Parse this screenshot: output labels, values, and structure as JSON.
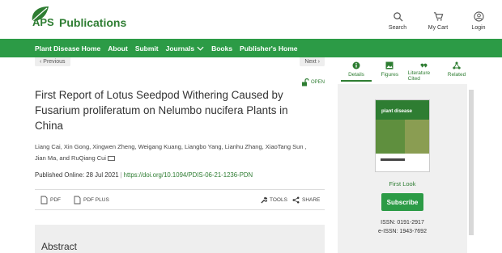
{
  "brand": {
    "aps": "APS",
    "publications": "Publications",
    "color": "#2e7d32"
  },
  "header": {
    "search_label": "Search",
    "cart_label": "My Cart",
    "login_label": "Login"
  },
  "nav": {
    "items": [
      "Plant Disease Home",
      "About",
      "Submit",
      "Journals",
      "Books",
      "Publisher's Home"
    ],
    "bg": "#2c9b46"
  },
  "pager": {
    "previous": "Previous",
    "next": "Next"
  },
  "open_badge": "OPEN",
  "article": {
    "title": "First Report of Lotus Seedpod Withering Caused by Fusarium proliferatum on Nelumbo nucifera Plants in China",
    "authors": "Liang Cai, Xin Gong, Xingwen Zheng, Weigang Kuang, Liangbo Yang, Lianhu Zhang, XiaoTang Sun , Jian Ma, and RuQiang Cui",
    "published_label": "Published Online:",
    "published_date": "28 Jul 2021",
    "doi": "https://doi.org/10.1094/PDIS-06-21-1236-PDN"
  },
  "actions": {
    "pdf": "PDF",
    "pdf_plus": "PDF PLUS",
    "tools": "TOOLS",
    "share": "SHARE"
  },
  "abstract_heading": "Abstract",
  "side": {
    "tabs": [
      "Details",
      "Figures",
      "Literature Cited",
      "Related"
    ],
    "cover_title": "plant disease",
    "first_look": "First Look",
    "subscribe": "Subscribe",
    "issn": "ISSN:  0191-2917",
    "eissn": "e-ISSN:  1943-7692"
  }
}
